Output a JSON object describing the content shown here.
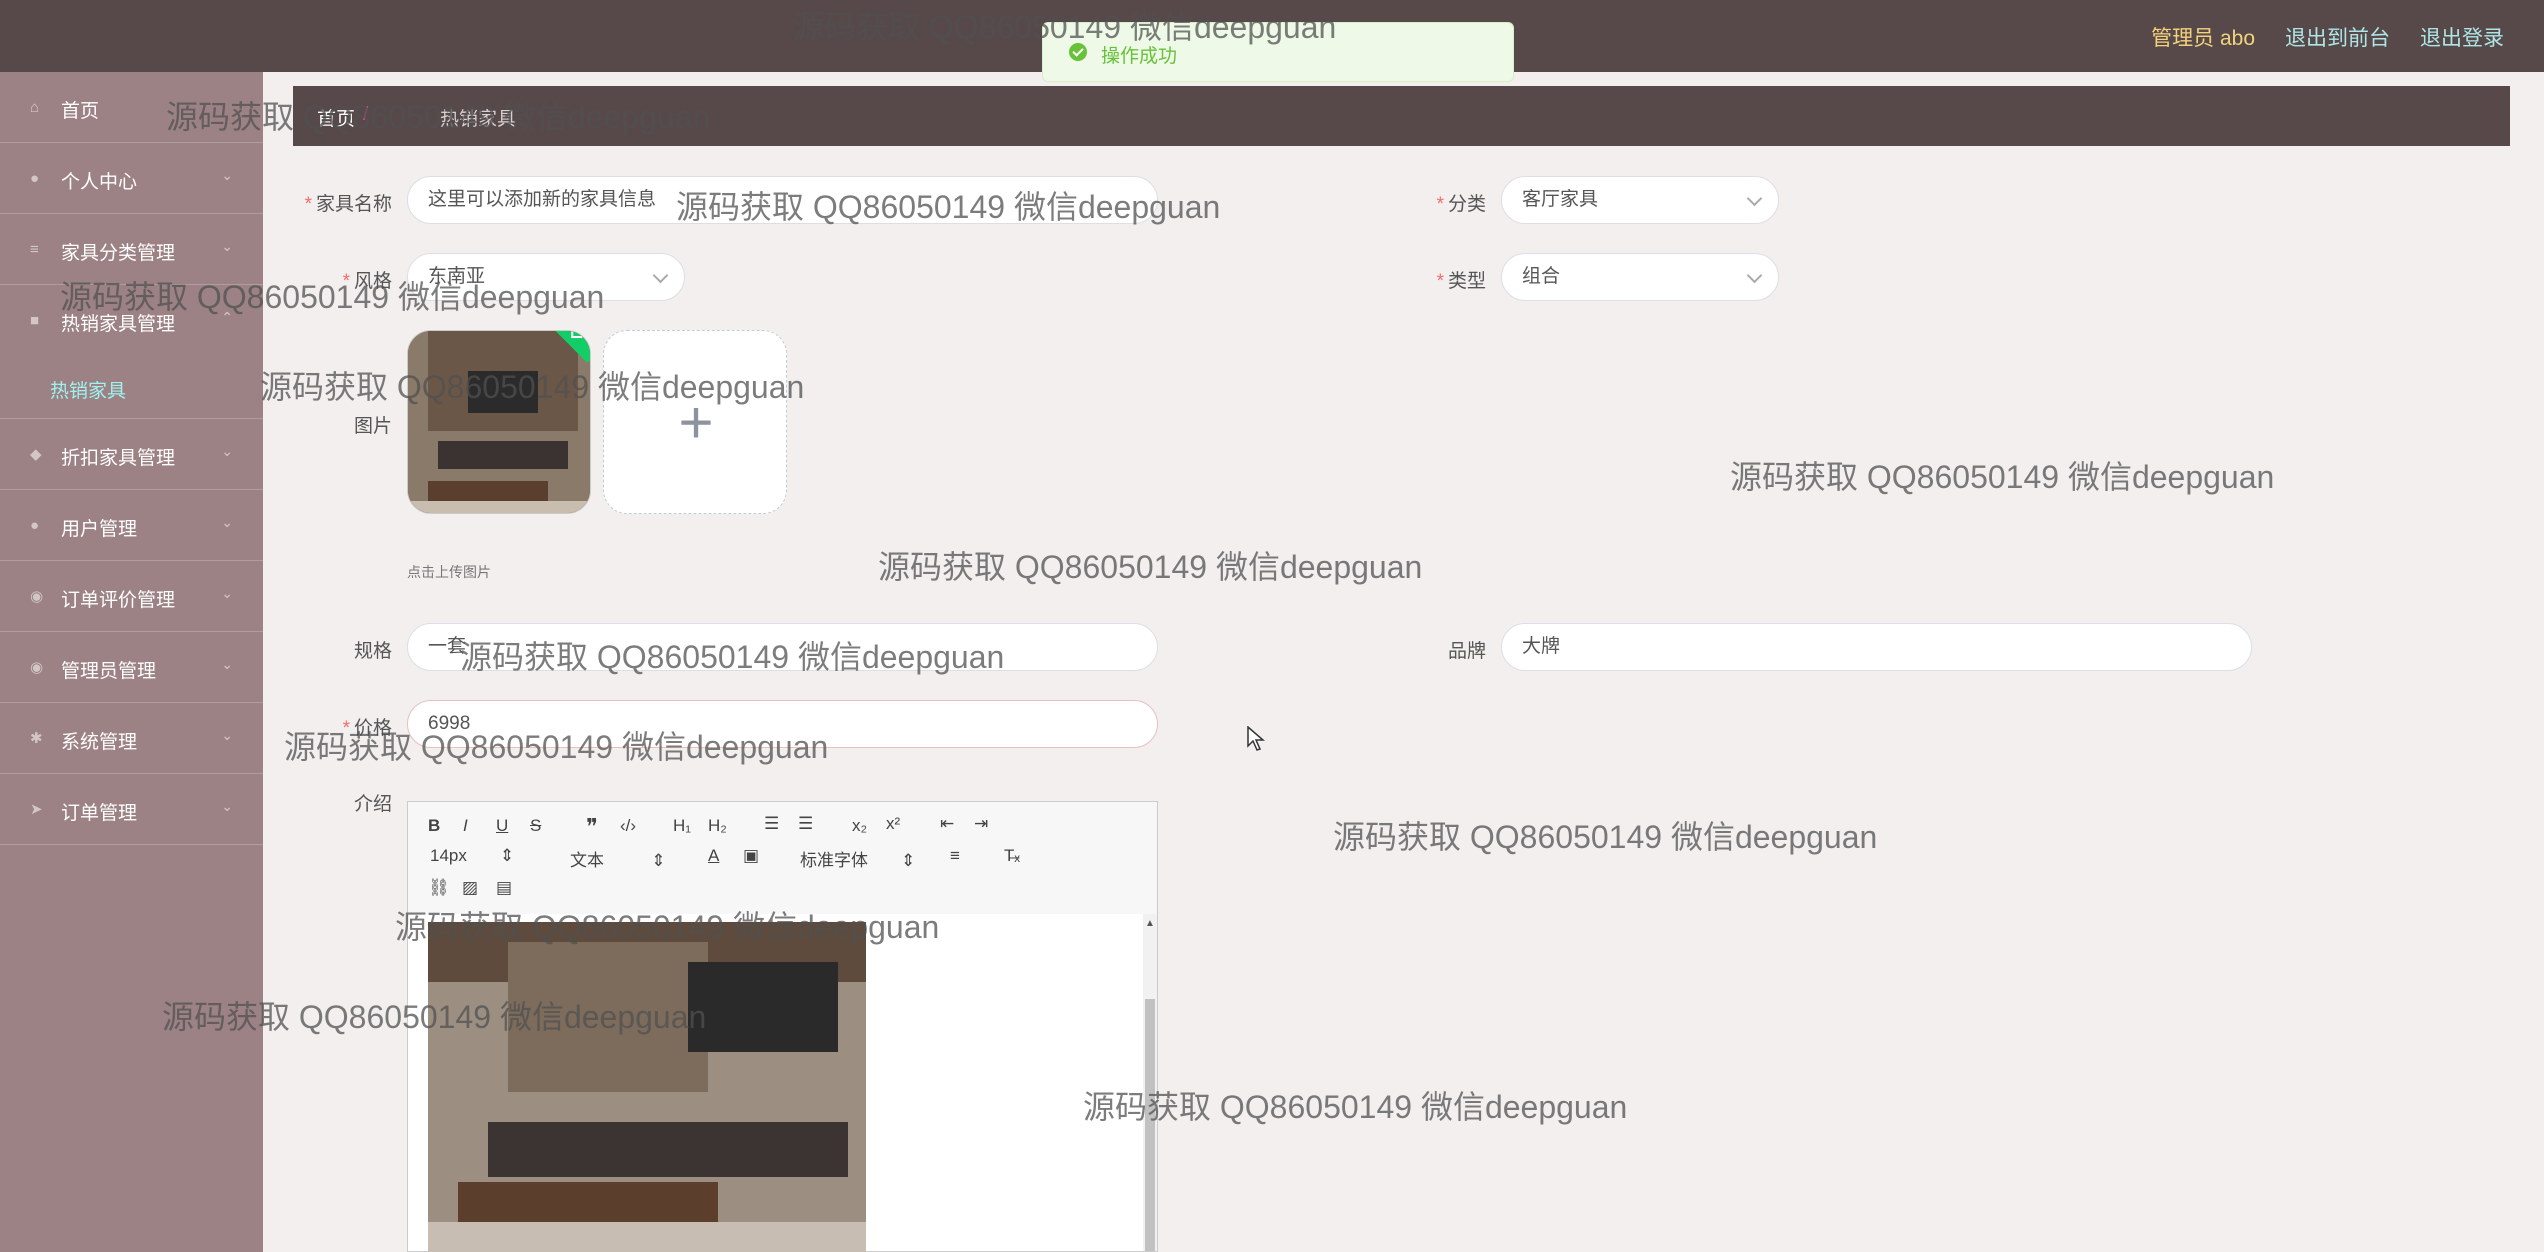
{
  "topbar": {
    "admin": "管理员 abo",
    "to_front": "退出到前台",
    "logout": "退出登录"
  },
  "toast": {
    "message": "操作成功"
  },
  "sidebar": {
    "items": [
      {
        "label": "首页"
      },
      {
        "label": "个人中心"
      },
      {
        "label": "家具分类管理"
      },
      {
        "label": "热销家具管理"
      },
      {
        "label": "折扣家具管理"
      },
      {
        "label": "用户管理"
      },
      {
        "label": "订单评价管理"
      },
      {
        "label": "管理员管理"
      },
      {
        "label": "系统管理"
      },
      {
        "label": "订单管理"
      }
    ],
    "sub_item": "热销家具"
  },
  "breadcrumb": {
    "home": "首页",
    "separator": "/",
    "current": "热销家具"
  },
  "form": {
    "name": {
      "label": "家具名称",
      "value": "这里可以添加新的家具信息"
    },
    "category": {
      "label": "分类",
      "value": "客厅家具"
    },
    "style": {
      "label": "风格",
      "value": "东南亚"
    },
    "type": {
      "label": "类型",
      "value": "组合"
    },
    "image": {
      "label": "图片",
      "hint": "点击上传图片"
    },
    "spec": {
      "label": "规格",
      "value": "一套"
    },
    "brand": {
      "label": "品牌",
      "value": "大牌"
    },
    "price": {
      "label": "价格",
      "value": "6998"
    },
    "intro": {
      "label": "介绍"
    }
  },
  "editor": {
    "font_size": "14px",
    "header": "文本",
    "font_family": "标准字体"
  },
  "watermark": "源码获取 QQ86050149 微信deepguan"
}
